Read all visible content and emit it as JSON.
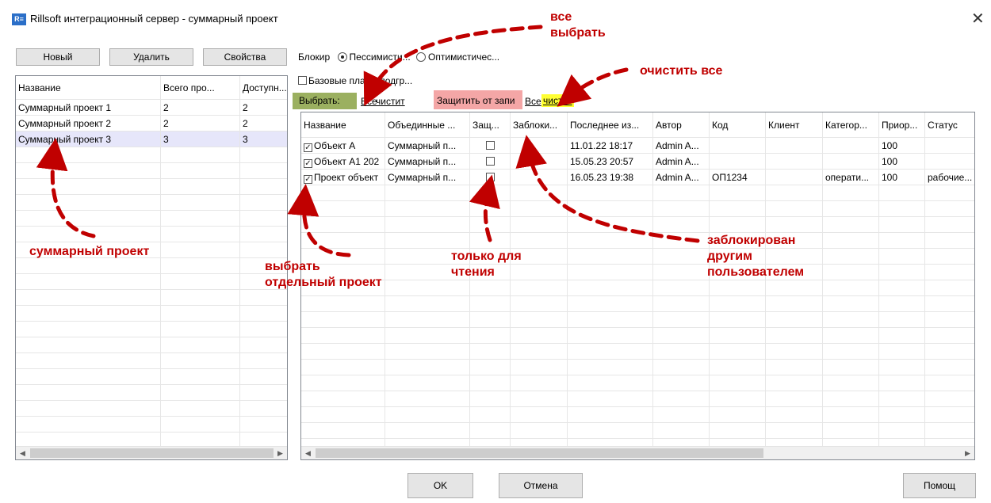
{
  "window": {
    "app_icon": "R≡",
    "title": "Rillsoft интеграционный сервер - суммарный проект",
    "close_icon": "close-icon",
    "close_glyph": "✕"
  },
  "left_toolbar": {
    "new": "Новый",
    "delete": "Удалить",
    "properties": "Свойства"
  },
  "left_grid": {
    "columns": [
      "Название",
      "Всего про...",
      "Доступн..."
    ],
    "rows": [
      [
        "Суммарный проект 1",
        "2",
        "2"
      ],
      [
        "Суммарный проект 2",
        "2",
        "2"
      ],
      [
        "Суммарный проект 3",
        "3",
        "3"
      ]
    ],
    "selected_row": 2
  },
  "options": {
    "block_label": "Блокир",
    "pessimistic": "Пессимисти...",
    "optimistic": "Оптимистичес...",
    "baseline": "Базовые планы подгр..."
  },
  "select_bar": {
    "select_label": "Выбрать:",
    "all": "Все",
    "clear": "чистит",
    "protect_label": "Защитить от запи",
    "protect_all": "Все",
    "protect_clear": "чистит"
  },
  "right_grid": {
    "columns": [
      "Название",
      "Объединные ...",
      "Защ...",
      "Заблоки...",
      "Последнее из...",
      "Автор",
      "Код",
      "Клиент",
      "Категор...",
      "Приор...",
      "Статус"
    ],
    "rows": [
      {
        "checked": true,
        "name": "Объект А",
        "merged": "Суммарный п...",
        "protected": false,
        "locked": "",
        "last": "11.01.22 18:17",
        "author": "Admin A...",
        "code": "",
        "client": "",
        "category": "",
        "priority": "100",
        "status": ""
      },
      {
        "checked": true,
        "name": "Объект А1 202",
        "merged": "Суммарный п...",
        "protected": false,
        "locked": "",
        "last": "15.05.23 20:57",
        "author": "Admin A...",
        "code": "",
        "client": "",
        "category": "",
        "priority": "100",
        "status": ""
      },
      {
        "checked": true,
        "name": "Проект объект",
        "merged": "Суммарный п...",
        "protected": false,
        "locked": "",
        "last": "16.05.23 19:38",
        "author": "Admin A...",
        "code": "ОП1234",
        "client": "",
        "category": "операти...",
        "priority": "100",
        "status": "рабочие..."
      }
    ]
  },
  "buttons": {
    "ok": "OK",
    "cancel": "Отмена",
    "help": "Помощ"
  },
  "annotations": {
    "select_all": "все\nвыбрать",
    "clear_all": "очистить все",
    "summary_project": "суммарный проект",
    "select_single": "выбрать\nотдельный проект",
    "read_only": "только для\nчтения",
    "locked_by_other": "заблокирован\nдругим\nпользователем"
  },
  "colors": {
    "select_bg": "#9bb060",
    "protect_bg": "#f4a6a6",
    "clear_highlight": "#ffff33",
    "annotation": "#c00000",
    "selected_row": "#e6e6fa"
  }
}
